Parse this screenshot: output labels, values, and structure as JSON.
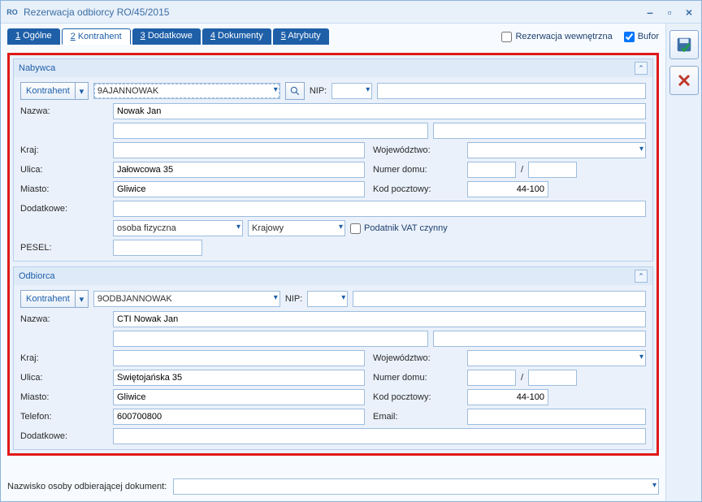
{
  "window": {
    "app_badge": "RO",
    "title": "Rezerwacja odbiorcy RO/45/2015"
  },
  "tabs": [
    {
      "hot": "1",
      "rest": " Ogólne"
    },
    {
      "hot": "2",
      "rest": " Kontrahent"
    },
    {
      "hot": "3",
      "rest": " Dodatkowe"
    },
    {
      "hot": "4",
      "rest": " Dokumenty"
    },
    {
      "hot": "5",
      "rest": " Atrybuty"
    }
  ],
  "header_checks": {
    "internal_label": "Rezerwacja wewnętrzna",
    "internal_checked": false,
    "buffer_label": "Bufor",
    "buffer_checked": true
  },
  "labels": {
    "kontrahent_btn": "Kontrahent",
    "nip": "NIP:",
    "nazwa": "Nazwa:",
    "kraj": "Kraj:",
    "wojewodztwo": "Województwo:",
    "ulica": "Ulica:",
    "numer_domu": "Numer domu:",
    "slash": "/",
    "miasto": "Miasto:",
    "kod_pocztowy": "Kod pocztowy:",
    "dodatkowe": "Dodatkowe:",
    "pesel": "PESEL:",
    "telefon": "Telefon:",
    "email": "Email:",
    "vat_czynny": "Podatnik VAT czynny",
    "odbierajacy": "Nazwisko osoby odbierającej dokument:"
  },
  "nabywca": {
    "section_title": "Nabywca",
    "kontrahent_code": "9AJANNOWAK",
    "nip": "",
    "nazwa": "Nowak Jan",
    "nazwa_extra1": "",
    "nazwa_extra2": "",
    "kraj": "",
    "wojewodztwo": "",
    "ulica": "Jałowcowa 35",
    "nr_domu": "",
    "nr_lokalu": "",
    "miasto": "Gliwice",
    "kod_pocztowy": "44-100",
    "dodatkowe": "",
    "typ_osoby": "osoba fizyczna",
    "zasieg": "Krajowy",
    "vat_czynny": false,
    "pesel": ""
  },
  "odbiorca": {
    "section_title": "Odbiorca",
    "kontrahent_code": "9ODBJANNOWAK",
    "nip": "",
    "nazwa": "CTI Nowak Jan",
    "nazwa_extra1": "",
    "nazwa_extra2": "",
    "kraj": "",
    "wojewodztwo": "",
    "ulica": "Świętojańska 35",
    "nr_domu": "",
    "nr_lokalu": "",
    "miasto": "Gliwice",
    "kod_pocztowy": "44-100",
    "telefon": "600700800",
    "email": "",
    "dodatkowe": ""
  },
  "recipient_name": ""
}
